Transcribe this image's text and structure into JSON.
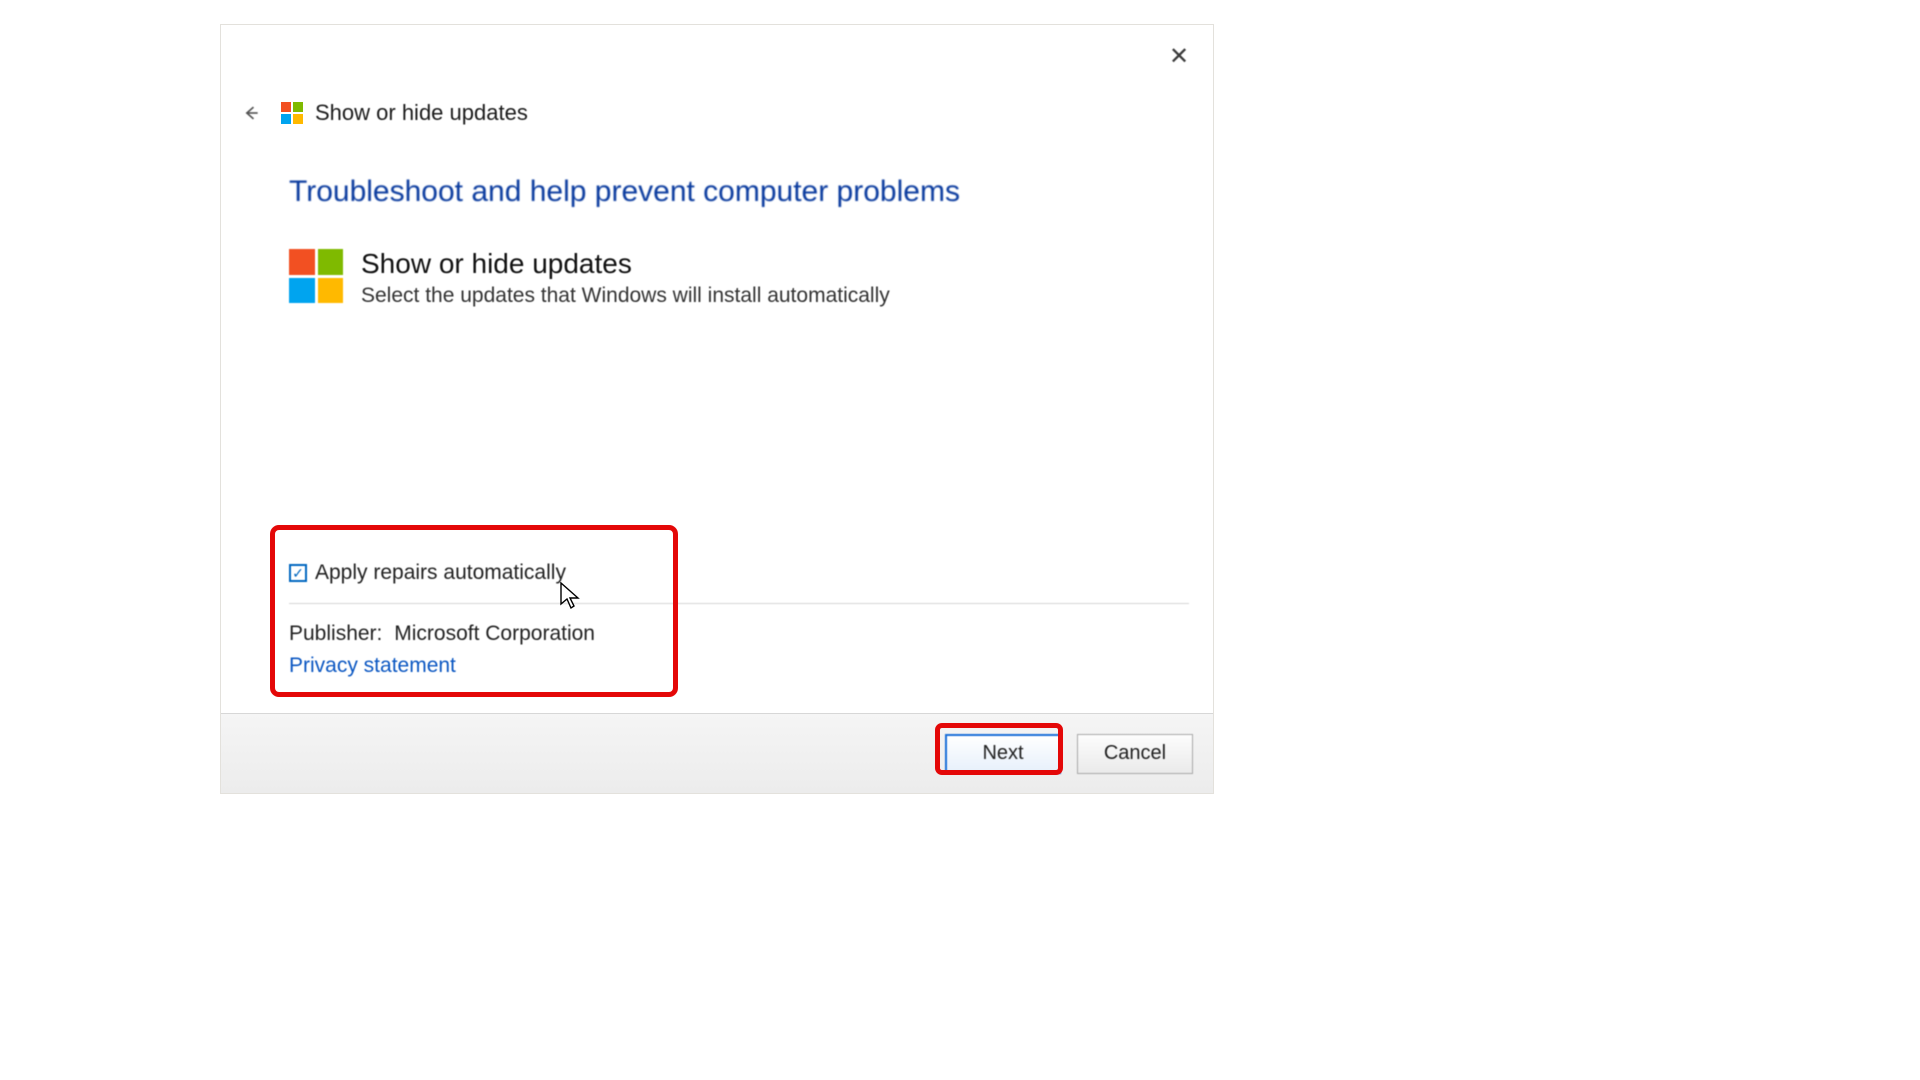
{
  "header": {
    "wizard_name": "Show or hide updates"
  },
  "main": {
    "headline": "Troubleshoot and help prevent computer problems",
    "item": {
      "title": "Show or hide updates",
      "description": "Select the updates that Windows will install automatically"
    }
  },
  "options": {
    "auto_repair_checked": true,
    "auto_repair_label": "Apply repairs automatically",
    "publisher_label": "Publisher:",
    "publisher_value": "Microsoft Corporation",
    "privacy_link": "Privacy statement"
  },
  "footer": {
    "next_label": "Next",
    "cancel_label": "Cancel"
  }
}
